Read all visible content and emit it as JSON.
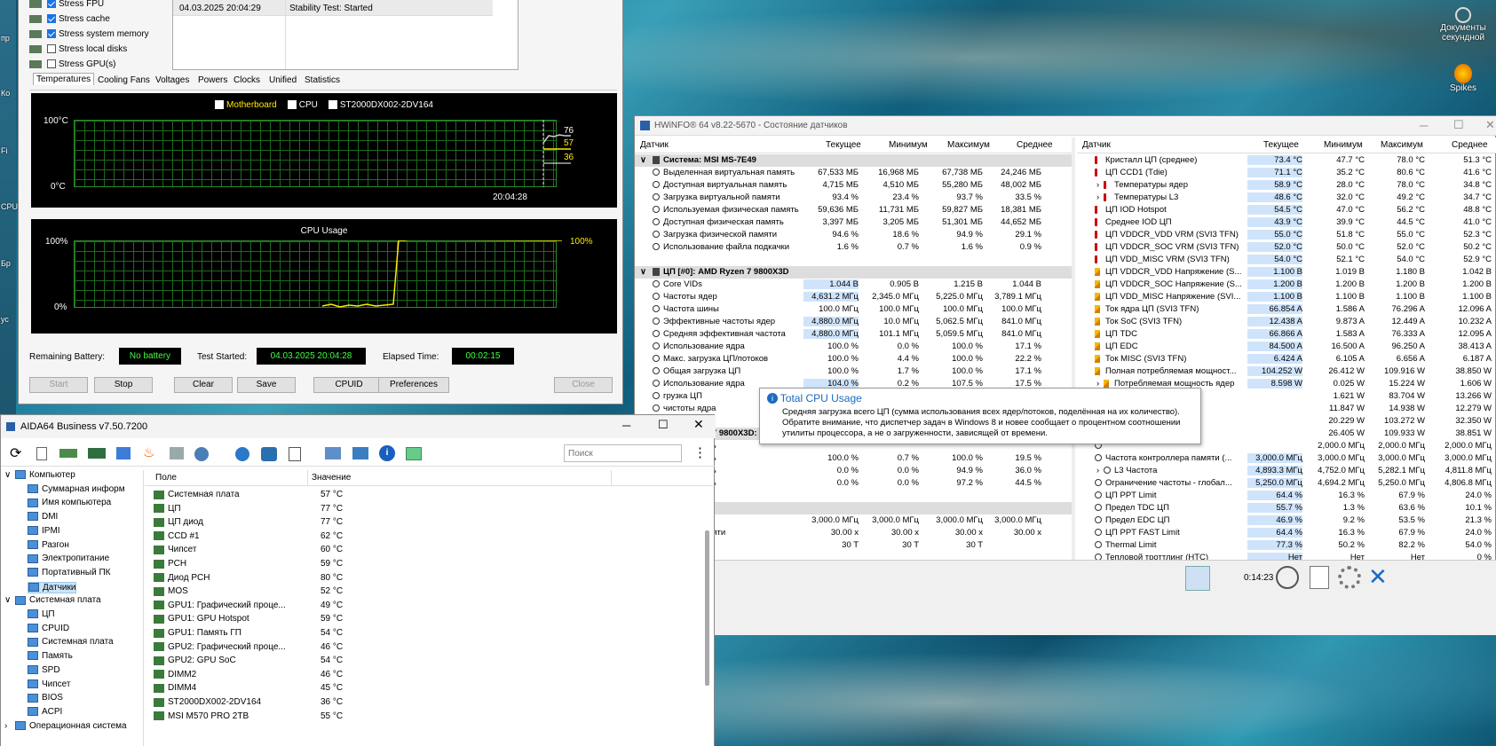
{
  "desktop": {
    "left_labels": [
      "пр",
      "Ко",
      "Fi",
      "СРU",
      "Бр",
      "ус"
    ],
    "right_icons": [
      {
        "label": "Документы секундной"
      },
      {
        "label": "Spikes"
      }
    ]
  },
  "stab": {
    "checks": [
      {
        "label": "Stress FPU",
        "checked": true
      },
      {
        "label": "Stress cache",
        "checked": true
      },
      {
        "label": "Stress system memory",
        "checked": true
      },
      {
        "label": "Stress local disks",
        "checked": false
      },
      {
        "label": "Stress GPU(s)",
        "checked": false
      }
    ],
    "log": {
      "time": "04.03.2025 20:04:29",
      "status": "Stability Test: Started"
    },
    "tabs": [
      "Temperatures",
      "Cooling Fans",
      "Voltages",
      "Powers",
      "Clocks",
      "Unified",
      "Statistics"
    ],
    "temp_graph": {
      "legend": [
        {
          "label": "Motherboard",
          "checked": true
        },
        {
          "label": "CPU",
          "checked": true
        },
        {
          "label": "ST2000DX002-2DV164",
          "checked": true
        }
      ],
      "y_top": "100°C",
      "y_bottom": "0°C",
      "time": "20:04:28",
      "values": [
        "76",
        "57",
        "36"
      ]
    },
    "cpu_graph": {
      "title": "CPU Usage",
      "y_top": "100%",
      "y_bottom": "0%",
      "value": "100%"
    },
    "battery_label": "Remaining Battery:",
    "battery": "No battery",
    "started_label": "Test Started:",
    "started": "04.03.2025 20:04:28",
    "elapsed_label": "Elapsed Time:",
    "elapsed": "00:02:15",
    "buttons": {
      "start": "Start",
      "stop": "Stop",
      "clear": "Clear",
      "save": "Save",
      "cpuid": "CPUID",
      "preferences": "Preferences",
      "close": "Close"
    }
  },
  "hw": {
    "title": "HWiNFO® 64 v8.22-5670 - Состояние датчиков",
    "headers": [
      "Датчик",
      "Текущее",
      "Минимум",
      "Максимум",
      "Среднее"
    ],
    "left_rows": [
      {
        "g": true,
        "name": "Система: MSI MS-7E49"
      },
      {
        "name": "Выделенная виртуальная память",
        "c": "67,533 МБ",
        "mn": "16,968 МБ",
        "mx": "67,738 МБ",
        "av": "24,246 МБ"
      },
      {
        "name": "Доступная виртуальная память",
        "c": "4,715 МБ",
        "mn": "4,510 МБ",
        "mx": "55,280 МБ",
        "av": "48,002 МБ"
      },
      {
        "name": "Загрузка виртуальной памяти",
        "c": "93.4 %",
        "mn": "23.4 %",
        "mx": "93.7 %",
        "av": "33.5 %"
      },
      {
        "name": "Используемая физическая память",
        "c": "59,636 МБ",
        "mn": "11,731 МБ",
        "mx": "59,827 МБ",
        "av": "18,381 МБ"
      },
      {
        "name": "Доступная физическая память",
        "c": "3,397 МБ",
        "mn": "3,205 МБ",
        "mx": "51,301 МБ",
        "av": "44,652 МБ"
      },
      {
        "name": "Загрузка физической памяти",
        "c": "94.6 %",
        "mn": "18.6 %",
        "mx": "94.9 %",
        "av": "29.1 %"
      },
      {
        "name": "Использование файла подкачки",
        "c": "1.6 %",
        "mn": "0.7 %",
        "mx": "1.6 %",
        "av": "0.9 %"
      },
      {
        "gap": true
      },
      {
        "g": true,
        "name": "ЦП [#0]: AMD Ryzen 7 9800X3D"
      },
      {
        "name": "Core VIDs",
        "c": "1.044 В",
        "mn": "0.905 В",
        "mx": "1.215 В",
        "av": "1.044 В",
        "hl": true
      },
      {
        "name": "Частоты ядер",
        "c": "4,631.2 МГц",
        "mn": "2,345.0 МГц",
        "mx": "5,225.0 МГц",
        "av": "3,789.1 МГц",
        "hl": true
      },
      {
        "name": "Частота шины",
        "c": "100.0 МГц",
        "mn": "100.0 МГц",
        "mx": "100.0 МГц",
        "av": "100.0 МГц"
      },
      {
        "name": "Эффективные частоты ядер",
        "c": "4,880.0 МГц",
        "mn": "10.0 МГц",
        "mx": "5,062.5 МГц",
        "av": "841.0 МГц",
        "hl": true
      },
      {
        "name": "Средняя эффективная частота",
        "c": "4,880.0 МГц",
        "mn": "101.1 МГц",
        "mx": "5,059.5 МГц",
        "av": "841.0 МГц",
        "hl": true
      },
      {
        "name": "Использование ядра",
        "c": "100.0 %",
        "mn": "0.0 %",
        "mx": "100.0 %",
        "av": "17.1 %"
      },
      {
        "name": "Макс. загрузка ЦП/потоков",
        "c": "100.0 %",
        "mn": "4.4 %",
        "mx": "100.0 %",
        "av": "22.2 %"
      },
      {
        "name": "Общая загрузка ЦП",
        "c": "100.0 %",
        "mn": "1.7 %",
        "mx": "100.0 %",
        "av": "17.1 %"
      },
      {
        "name": "Использование ядра",
        "c": "104.0 %",
        "mn": "0.2 %",
        "mx": "107.5 %",
        "av": "17.5 %",
        "hl": true
      },
      {
        "name": "грузка ЦП",
        "c": "",
        "mn": "",
        "mx": "",
        "av": ""
      },
      {
        "name": "чистоты ядра",
        "c": "",
        "mn": "",
        "mx": "",
        "av": ""
      },
      {
        "gap": true
      },
      {
        "g": true,
        "name": "AMD Ryzen 7 9800X3D: C"
      },
      {
        "name": "езидентность",
        "c": "",
        "mn": "",
        "mx": "",
        "av": ""
      },
      {
        "name": "езидентность",
        "c": "100.0 %",
        "mn": "0.7 %",
        "mx": "100.0 %",
        "av": "19.5 %"
      },
      {
        "name": "езидентность",
        "c": "0.0 %",
        "mn": "0.0 %",
        "mx": "94.9 %",
        "av": "36.0 %"
      },
      {
        "name": "езидентность",
        "c": "0.0 %",
        "mn": "0.0 %",
        "mx": "97.2 %",
        "av": "44.5 %"
      },
      {
        "gap": true
      },
      {
        "g": true,
        "name": "амяти"
      },
      {
        "name": "яти",
        "c": "3,000.0 МГц",
        "mn": "3,000.0 МГц",
        "mx": "3,000.0 МГц",
        "av": "3,000.0 МГц"
      },
      {
        "name": "настоты памяти",
        "c": "30.00 x",
        "mn": "30.00 x",
        "mx": "30.00 x",
        "av": "30.00 x"
      },
      {
        "name": "",
        "c": "30 T",
        "mn": "30 T",
        "mx": "30 T",
        "av": ""
      }
    ],
    "right_rows": [
      {
        "i": "t",
        "name": "Кристалл ЦП (среднее)",
        "c": "73.4 °C",
        "mn": "47.7 °C",
        "mx": "78.0 °C",
        "av": "51.3 °C"
      },
      {
        "i": "t",
        "name": "ЦП CCD1 (Tdie)",
        "c": "71.1 °C",
        "mn": "35.2 °C",
        "mx": "80.6 °C",
        "av": "41.6 °C"
      },
      {
        "i": "t",
        "name": "Температуры ядер",
        "c": "58.9 °C",
        "mn": "28.0 °C",
        "mx": "78.0 °C",
        "av": "34.8 °C",
        "x": true
      },
      {
        "i": "t",
        "name": "Температуры L3",
        "c": "48.6 °C",
        "mn": "32.0 °C",
        "mx": "49.2 °C",
        "av": "34.7 °C",
        "x": true
      },
      {
        "i": "t",
        "name": "ЦП IOD Hotspot",
        "c": "54.5 °C",
        "mn": "47.0 °C",
        "mx": "56.2 °C",
        "av": "48.8 °C"
      },
      {
        "i": "t",
        "name": "Среднее IOD ЦП",
        "c": "43.9 °C",
        "mn": "39.9 °C",
        "mx": "44.5 °C",
        "av": "41.0 °C"
      },
      {
        "i": "t",
        "name": "ЦП VDDCR_VDD VRM (SVI3 TFN)",
        "c": "55.0 °C",
        "mn": "51.8 °C",
        "mx": "55.0 °C",
        "av": "52.3 °C"
      },
      {
        "i": "t",
        "name": "ЦП VDDCR_SOC VRM (SVI3 TFN)",
        "c": "52.0 °C",
        "mn": "50.0 °C",
        "mx": "52.0 °C",
        "av": "50.2 °C"
      },
      {
        "i": "t",
        "name": "ЦП VDD_MISC VRM (SVI3 TFN)",
        "c": "54.0 °C",
        "mn": "52.1 °C",
        "mx": "54.0 °C",
        "av": "52.9 °C"
      },
      {
        "i": "b",
        "name": "ЦП VDDCR_VDD Напряжение (S...",
        "c": "1.100 В",
        "mn": "1.019 В",
        "mx": "1.180 В",
        "av": "1.042 В"
      },
      {
        "i": "b",
        "name": "ЦП VDDCR_SOC Напряжение (S...",
        "c": "1.200 В",
        "mn": "1.200 В",
        "mx": "1.200 В",
        "av": "1.200 В"
      },
      {
        "i": "b",
        "name": "ЦП VDD_MISC Напряжение (SVI...",
        "c": "1.100 В",
        "mn": "1.100 В",
        "mx": "1.100 В",
        "av": "1.100 В"
      },
      {
        "i": "b",
        "name": "Ток ядра ЦП (SVI3 TFN)",
        "c": "66.854 A",
        "mn": "1.586 A",
        "mx": "76.296 A",
        "av": "12.096 A"
      },
      {
        "i": "b",
        "name": "Ток SoC (SVI3 TFN)",
        "c": "12.438 A",
        "mn": "9.873 A",
        "mx": "12.449 A",
        "av": "10.232 A"
      },
      {
        "i": "b",
        "name": "ЦП TDC",
        "c": "66.866 A",
        "mn": "1.583 A",
        "mx": "76.333 A",
        "av": "12.095 A"
      },
      {
        "i": "b",
        "name": "ЦП EDC",
        "c": "84.500 A",
        "mn": "16.500 A",
        "mx": "96.250 A",
        "av": "38.413 A"
      },
      {
        "i": "b",
        "name": "Ток MISC (SVI3 TFN)",
        "c": "6.424 A",
        "mn": "6.105 A",
        "mx": "6.656 A",
        "av": "6.187 A"
      },
      {
        "i": "b",
        "name": "Полная потребляемая мощност...",
        "c": "104.252 W",
        "mn": "26.412 W",
        "mx": "109.916 W",
        "av": "38.850 W"
      },
      {
        "i": "b",
        "name": "Потребляемая мощность ядер",
        "c": "8.598 W",
        "mn": "0.025 W",
        "mx": "15.224 W",
        "av": "1.606 W",
        "x": true
      },
      {
        "i": "b",
        "name": "",
        "c": "",
        "mn": "1.621 W",
        "mx": "83.704 W",
        "av": "13.266 W"
      },
      {
        "i": "b",
        "name": "",
        "c": "",
        "mn": "11.847 W",
        "mx": "14.938 W",
        "av": "12.279 W"
      },
      {
        "i": "b",
        "name": "",
        "c": "",
        "mn": "20.229 W",
        "mx": "103.272 W",
        "av": "32.350 W"
      },
      {
        "i": "b",
        "name": "",
        "c": "",
        "mn": "26.405 W",
        "mx": "109.933 W",
        "av": "38.851 W"
      },
      {
        "i": "c",
        "name": "",
        "c": "",
        "mn": "2,000.0 МГц",
        "mx": "2,000.0 МГц",
        "av": "2,000.0 МГц"
      },
      {
        "i": "c",
        "name": "Частота контроллера памяти (...",
        "c": "3,000.0 МГц",
        "mn": "3,000.0 МГц",
        "mx": "3,000.0 МГц",
        "av": "3,000.0 МГц"
      },
      {
        "i": "c",
        "name": "L3 Частота",
        "c": "4,893.3 МГц",
        "mn": "4,752.0 МГц",
        "mx": "5,282.1 МГц",
        "av": "4,811.8 МГц",
        "x": true
      },
      {
        "i": "c",
        "name": "Ограничение частоты - глобал...",
        "c": "5,250.0 МГц",
        "mn": "4,694.2 МГц",
        "mx": "5,250.0 МГц",
        "av": "4,806.8 МГц"
      },
      {
        "i": "c",
        "name": "ЦП PPT Limit",
        "c": "64.4 %",
        "mn": "16.3 %",
        "mx": "67.9 %",
        "av": "24.0 %"
      },
      {
        "i": "c",
        "name": "Предел TDC ЦП",
        "c": "55.7 %",
        "mn": "1.3 %",
        "mx": "63.6 %",
        "av": "10.1 %"
      },
      {
        "i": "c",
        "name": "Предел EDC ЦП",
        "c": "46.9 %",
        "mn": "9.2 %",
        "mx": "53.5 %",
        "av": "21.3 %"
      },
      {
        "i": "c",
        "name": "ЦП PPT FAST Limit",
        "c": "64.4 %",
        "mn": "16.3 %",
        "mx": "67.9 %",
        "av": "24.0 %"
      },
      {
        "i": "c",
        "name": "Thermal Limit",
        "c": "77.3 %",
        "mn": "50.2 %",
        "mx": "82.2 %",
        "av": "54.0 %"
      },
      {
        "i": "c",
        "name": "Тепловой троттлинг (HTC)",
        "c": "Нет",
        "mn": "Нет",
        "mx": "Нет",
        "av": "0 %"
      }
    ],
    "timer": "0:14:23",
    "tooltip": {
      "title": "Total CPU Usage",
      "body": "Средняя загрузка всего ЦП (сумма использования всех ядер/потоков, поделённая на их количество). Обратите внимание, что диспетчер задач в Windows 8 и новее сообщает о процентном соотношении утилиты процессора, а не о загруженности, зависящей от времени."
    }
  },
  "aida": {
    "title": "AIDA64 Business v7.50.7200",
    "search_placeholder": "Поиск",
    "tree": [
      {
        "label": "Компьютер",
        "lvl": 0,
        "exp": "v"
      },
      {
        "label": "Суммарная информ",
        "lvl": 1
      },
      {
        "label": "Имя компьютера",
        "lvl": 1
      },
      {
        "label": "DMI",
        "lvl": 1
      },
      {
        "label": "IPMI",
        "lvl": 1
      },
      {
        "label": "Разгон",
        "lvl": 1
      },
      {
        "label": "Электропитание",
        "lvl": 1
      },
      {
        "label": "Портативный ПК",
        "lvl": 1
      },
      {
        "label": "Датчики",
        "lvl": 1,
        "sel": true
      },
      {
        "label": "Системная плата",
        "lvl": 0,
        "exp": "v"
      },
      {
        "label": "ЦП",
        "lvl": 1
      },
      {
        "label": "CPUID",
        "lvl": 1
      },
      {
        "label": "Системная плата",
        "lvl": 1
      },
      {
        "label": "Память",
        "lvl": 1
      },
      {
        "label": "SPD",
        "lvl": 1
      },
      {
        "label": "Чипсет",
        "lvl": 1
      },
      {
        "label": "BIOS",
        "lvl": 1
      },
      {
        "label": "ACPI",
        "lvl": 1
      },
      {
        "label": "Операционная система",
        "lvl": 0,
        "exp": ">"
      }
    ],
    "col_field": "Поле",
    "col_value": "Значение",
    "rows": [
      {
        "f": "Системная плата",
        "v": "57 °C"
      },
      {
        "f": "ЦП",
        "v": "77 °C"
      },
      {
        "f": "ЦП диод",
        "v": "77 °C"
      },
      {
        "f": "CCD #1",
        "v": "62 °C"
      },
      {
        "f": "Чипсет",
        "v": "60 °C"
      },
      {
        "f": "PCH",
        "v": "59 °C"
      },
      {
        "f": "Диод PCH",
        "v": "80 °C"
      },
      {
        "f": "MOS",
        "v": "52 °C"
      },
      {
        "f": "GPU1: Графический проце...",
        "v": "49 °C"
      },
      {
        "f": "GPU1: GPU Hotspot",
        "v": "59 °C"
      },
      {
        "f": "GPU1: Память ГП",
        "v": "54 °C"
      },
      {
        "f": "GPU2: Графический проце...",
        "v": "46 °C"
      },
      {
        "f": "GPU2: GPU SoC",
        "v": "54 °C"
      },
      {
        "f": "DIMM2",
        "v": "46 °C"
      },
      {
        "f": "DIMM4",
        "v": "45 °C"
      },
      {
        "f": "ST2000DX002-2DV164",
        "v": "36 °C"
      },
      {
        "f": "MSI M570 PRO 2TB",
        "v": "55 °C"
      }
    ]
  }
}
